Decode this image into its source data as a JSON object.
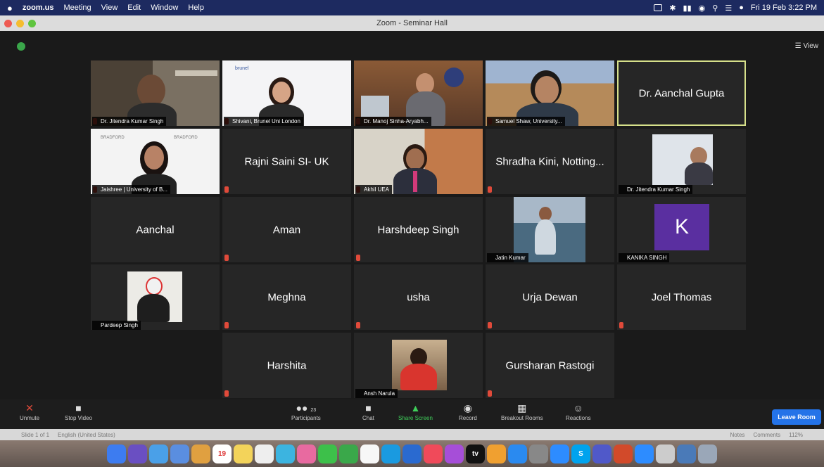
{
  "menubar": {
    "app": "zoom.us",
    "items": [
      "Meeting",
      "View",
      "Edit",
      "Window",
      "Help"
    ],
    "clock": "Fri 19 Feb 3:22 PM"
  },
  "window": {
    "title": "Zoom - Seminar Hall"
  },
  "view_label": "View",
  "participants": {
    "t1": "Dr. Jitendra Kumar Singh",
    "t2": "Shivani, Brunel Uni London",
    "t3": "Dr. Manoj Sinha-Aryabh...",
    "t4": "Samuel Shaw, University...",
    "t5": "Dr. Aanchal Gupta",
    "t6": "Jaishree | University of B...",
    "t7": "Rajni Saini SI- UK",
    "t8": "Akhil UEA",
    "t9": "Shradha Kini, Notting...",
    "t10": "Dr. Jitendra Kumar Singh",
    "t11": "Aanchal",
    "t12": "Aman",
    "t13": "Harshdeep Singh",
    "t14": "Jatin Kumar",
    "t15": "KANIKA SINGH",
    "t15_initial": "K",
    "t16": "Pardeep Singh",
    "t17": "Meghna",
    "t18": "usha",
    "t19": "Urja Dewan",
    "t20": "Joel Thomas",
    "t21": "Harshita",
    "t22": "Ansh Narula",
    "t23": "Gursharan Rastogi"
  },
  "backdrop": {
    "bradford": "BRADFORD",
    "brunel": "brunel"
  },
  "toolbar": {
    "unmute": "Unmute",
    "stop_video": "Stop Video",
    "participants": "Participants",
    "participant_count": "23",
    "chat": "Chat",
    "share": "Share Screen",
    "record": "Record",
    "breakout": "Breakout Rooms",
    "reactions": "Reactions",
    "leave": "Leave Room"
  },
  "status": {
    "slide": "Slide 1 of 1",
    "lang": "English (United States)",
    "notes": "Notes",
    "comments": "Comments",
    "zoom": "112%"
  },
  "dock": {
    "calendar_day": "19",
    "tv": "tv",
    "skype": "S"
  },
  "colors": {
    "accent_green": "#3fcf5a",
    "leave_blue": "#2473e8",
    "active_border": "#d6e08a"
  }
}
